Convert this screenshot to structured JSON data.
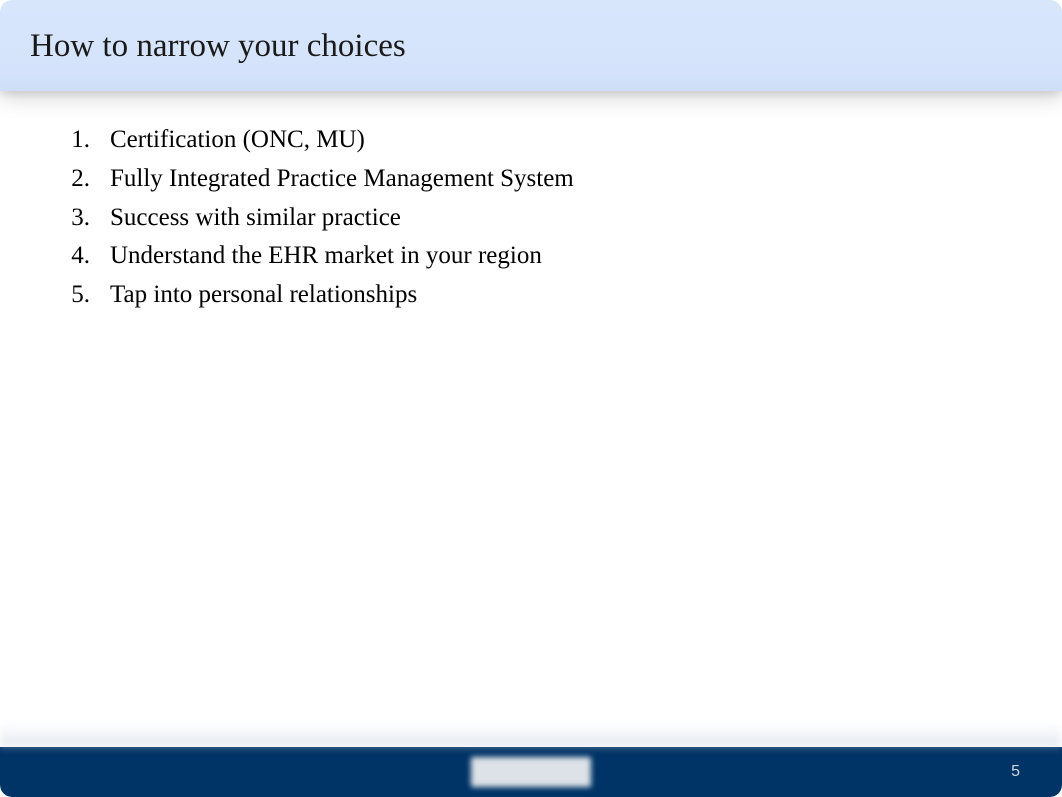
{
  "header": {
    "title": "How to narrow your choices"
  },
  "content": {
    "items": [
      "Certification (ONC, MU)",
      "Fully Integrated Practice Management System",
      "Success with similar practice",
      "Understand the EHR market in your region",
      "Tap into personal relationships"
    ]
  },
  "footer": {
    "page_number": "5"
  }
}
